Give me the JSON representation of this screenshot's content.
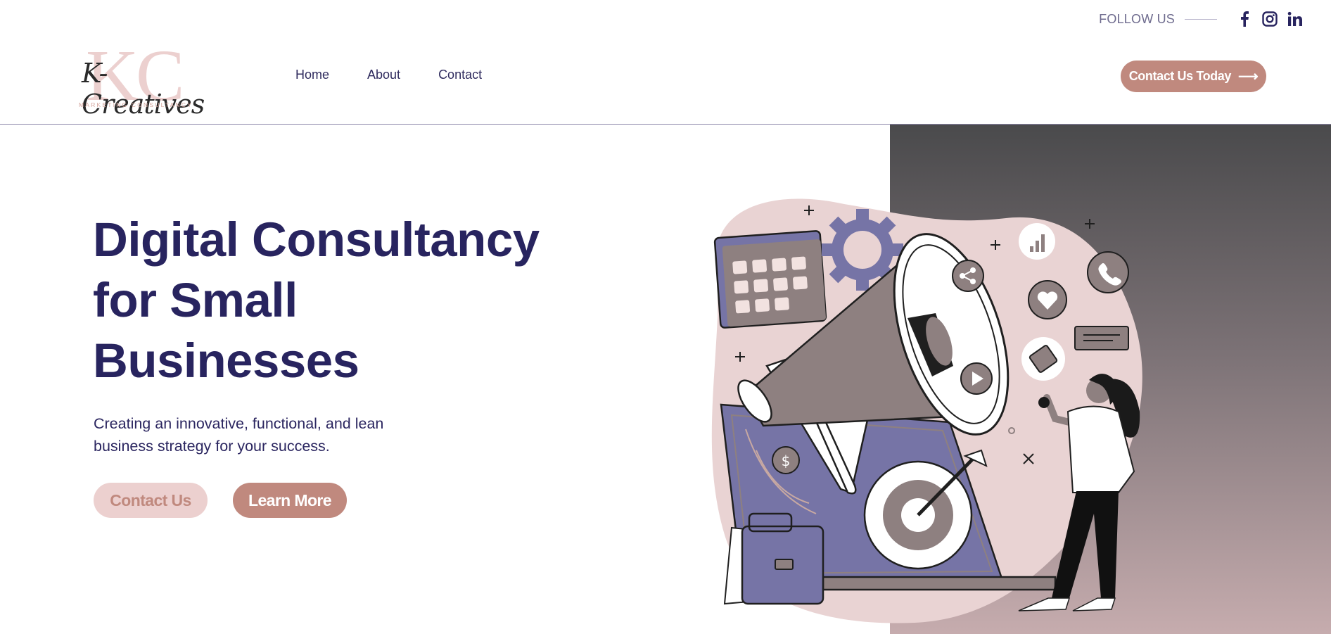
{
  "header": {
    "logo": {
      "monogram": "KC",
      "script": "K-Creatives",
      "tagline": "MARKETING CONSULTANCY"
    },
    "nav": [
      {
        "label": "Home"
      },
      {
        "label": "About"
      },
      {
        "label": "Contact"
      }
    ],
    "cta": {
      "label": "Contact Us Today",
      "arrow": "⟶"
    },
    "follow": {
      "label": "FOLLOW US",
      "icons": [
        "facebook-icon",
        "instagram-icon",
        "linkedin-icon"
      ]
    }
  },
  "hero": {
    "headline": [
      "Digital Consultancy",
      "for Small",
      "Businesses"
    ],
    "subtext": "Creating an innovative, functional, and lean business strategy for your success.",
    "buttons": {
      "contact": "Contact Us",
      "learn": "Learn More"
    },
    "illustration": "marketing-megaphone-illustration"
  },
  "colors": {
    "navy": "#28245f",
    "rose": "#c0897e",
    "blush": "#ecd0cf",
    "purple": "#7070a0",
    "taupe": "#8e8080"
  }
}
